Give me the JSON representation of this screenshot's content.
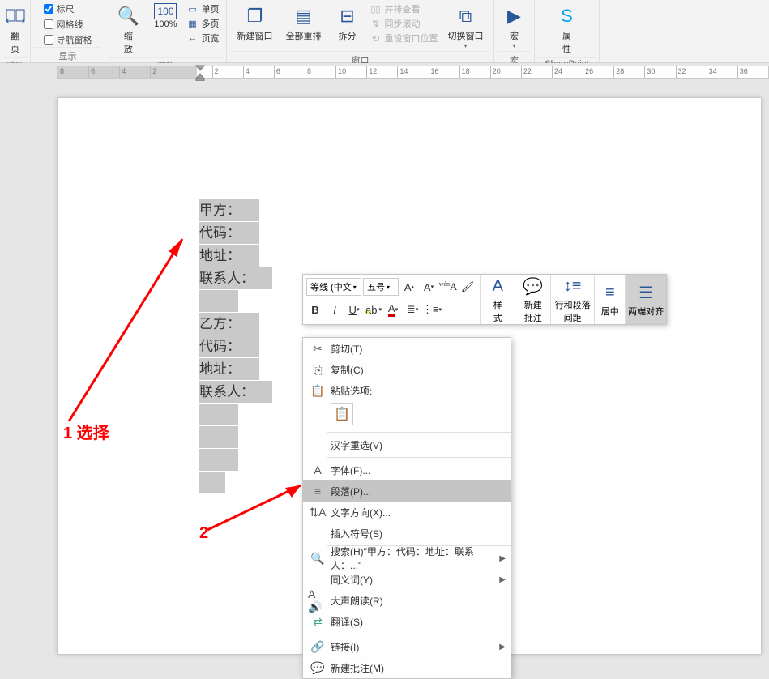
{
  "ribbon": {
    "g_move": {
      "btn": "翻\n页",
      "label": "移动"
    },
    "g_show": {
      "label": "显示",
      "ruler": "标尺",
      "grid": "网格线",
      "nav": "导航窗格"
    },
    "g_zoom": {
      "label": "缩放",
      "zoom": "缩\n放",
      "p100": "100%",
      "single": "单页",
      "multi": "多页",
      "width": "页宽"
    },
    "g_win": {
      "label": "窗口",
      "newwin": "新建窗口",
      "arrange": "全部重排",
      "split": "拆分",
      "side": "并排查看",
      "sync": "同步滚动",
      "reset": "重设窗口位置",
      "switch": "切换窗口"
    },
    "g_macro": {
      "label": "宏",
      "btn": "宏"
    },
    "g_sp": {
      "label": "SharePoint",
      "btn": "属\n性"
    }
  },
  "ruler_ticks": [
    "8",
    "6",
    "4",
    "2",
    "",
    "2",
    "4",
    "6",
    "8",
    "10",
    "12",
    "14",
    "16",
    "18",
    "20",
    "22",
    "24",
    "26",
    "28",
    "30",
    "32",
    "34",
    "36"
  ],
  "doc": {
    "l1": "甲方：",
    "l2": "代码：",
    "l3": "地址：",
    "l4": "联系人：",
    "l5": "乙方：",
    "l6": "代码：",
    "l7": "地址：",
    "l8": "联系人："
  },
  "annot": {
    "a1": "1 选择",
    "a2": "2"
  },
  "mini": {
    "font": "等线 (中文",
    "size": "五号",
    "style_lbl": "样\n式",
    "note_lbl": "新建\n批注",
    "spacing_lbl": "行和段落\n间距",
    "center_lbl": "居中",
    "justify_lbl": "两端对齐"
  },
  "ctx": {
    "cut": "剪切(T)",
    "copy": "复制(C)",
    "paste_hdr": "粘贴选项:",
    "hanzi": "汉字重选(V)",
    "font": "字体(F)...",
    "para": "段落(P)...",
    "dir": "文字方向(X)...",
    "sym": "插入符号(S)",
    "search": "搜索(H)\"甲方：代码：地址：联系人：...\"",
    "syn": "同义词(Y)",
    "read": "大声朗读(R)",
    "trans": "翻译(S)",
    "link": "链接(I)",
    "newcmt": "新建批注(M)"
  }
}
